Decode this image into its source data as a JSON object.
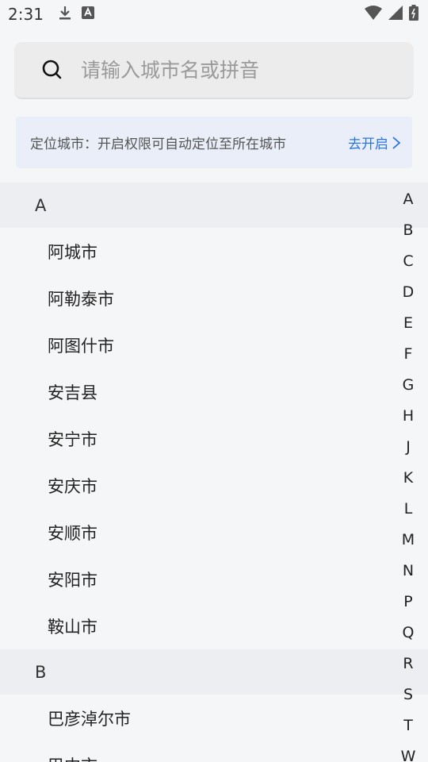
{
  "status_bar": {
    "time": "2:31",
    "icons_left": [
      "download-icon",
      "app-notification-icon"
    ],
    "icons_right": [
      "wifi-icon",
      "cell-signal-icon",
      "battery-icon"
    ]
  },
  "search": {
    "placeholder": "请输入城市名或拼音",
    "icon": "search-icon"
  },
  "location": {
    "text": "定位城市：开启权限可自动定位至所在城市",
    "action_label": "去开启",
    "action_color": "#2a74e8"
  },
  "sections": [
    {
      "letter": "A",
      "cities": [
        "阿城市",
        "阿勒泰市",
        "阿图什市",
        "安吉县",
        "安宁市",
        "安庆市",
        "安顺市",
        "安阳市",
        "鞍山市"
      ]
    },
    {
      "letter": "B",
      "cities": [
        "巴彦淖尔市",
        "巴中市"
      ]
    }
  ],
  "index_letters": [
    "A",
    "B",
    "C",
    "D",
    "E",
    "F",
    "G",
    "H",
    "J",
    "K",
    "L",
    "M",
    "N",
    "P",
    "Q",
    "R",
    "S",
    "T",
    "W"
  ]
}
